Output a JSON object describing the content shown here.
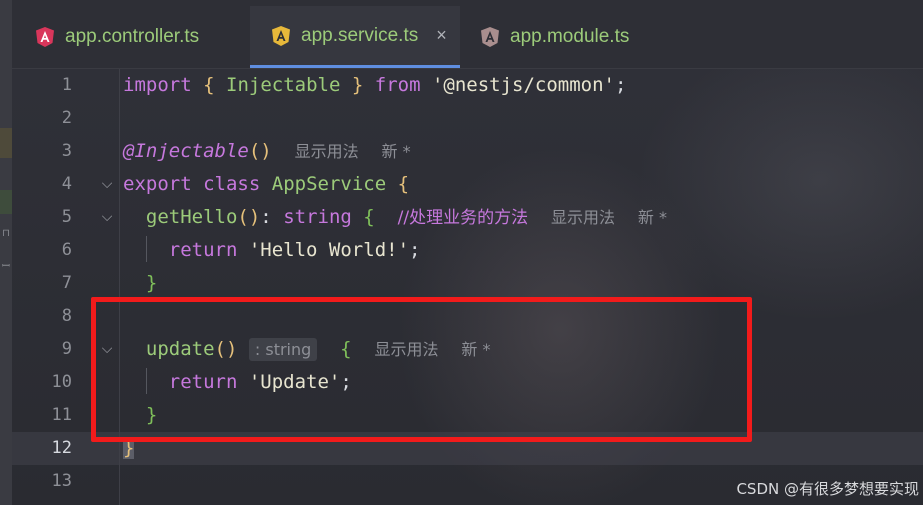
{
  "tabs": [
    {
      "label": "app.controller.ts",
      "icon": "angular-icon"
    },
    {
      "label": "app.service.ts",
      "icon": "angular-icon",
      "active": true,
      "close": "×"
    },
    {
      "label": "app.module.ts",
      "icon": "angular-icon"
    }
  ],
  "line_numbers": [
    "1",
    "2",
    "3",
    "4",
    "5",
    "6",
    "7",
    "8",
    "9",
    "10",
    "11",
    "12",
    "13"
  ],
  "current_line": "12",
  "code": {
    "l1": {
      "import": "import",
      "lb": "{",
      "name": "Injectable",
      "rb": "}",
      "from": "from",
      "path": "'@nestjs/common'",
      "semi": ";"
    },
    "l3": {
      "decorator": "@Injectable",
      "parens": "()",
      "hint1": "显示用法",
      "hint2": "新 *"
    },
    "l4": {
      "export": "export",
      "class": "class",
      "name": "AppService",
      "brace": "{"
    },
    "l5": {
      "fn": "getHello",
      "parens": "()",
      "colon": ":",
      "type": "string",
      "brace": "{",
      "comment": "//处理业务的方法",
      "hint1": "显示用法",
      "hint2": "新 *"
    },
    "l6": {
      "ret": "return",
      "str": "'Hello World!'",
      "semi": ";"
    },
    "l7": {
      "brace": "}"
    },
    "l9": {
      "fn": "update",
      "parens": "()",
      "typehint": ": string",
      "brace": "{",
      "hint1": "显示用法",
      "hint2": "新 *"
    },
    "l10": {
      "ret": "return",
      "str": "'Update'",
      "semi": ";"
    },
    "l11": {
      "brace": "}"
    },
    "l12": {
      "brace": "}"
    }
  },
  "watermark": "CSDN @有很多梦想要实现",
  "colors": {
    "highlight_box": "#f21b1b",
    "tab_text": "#9ccb7a",
    "keyword": "#c678dd"
  }
}
